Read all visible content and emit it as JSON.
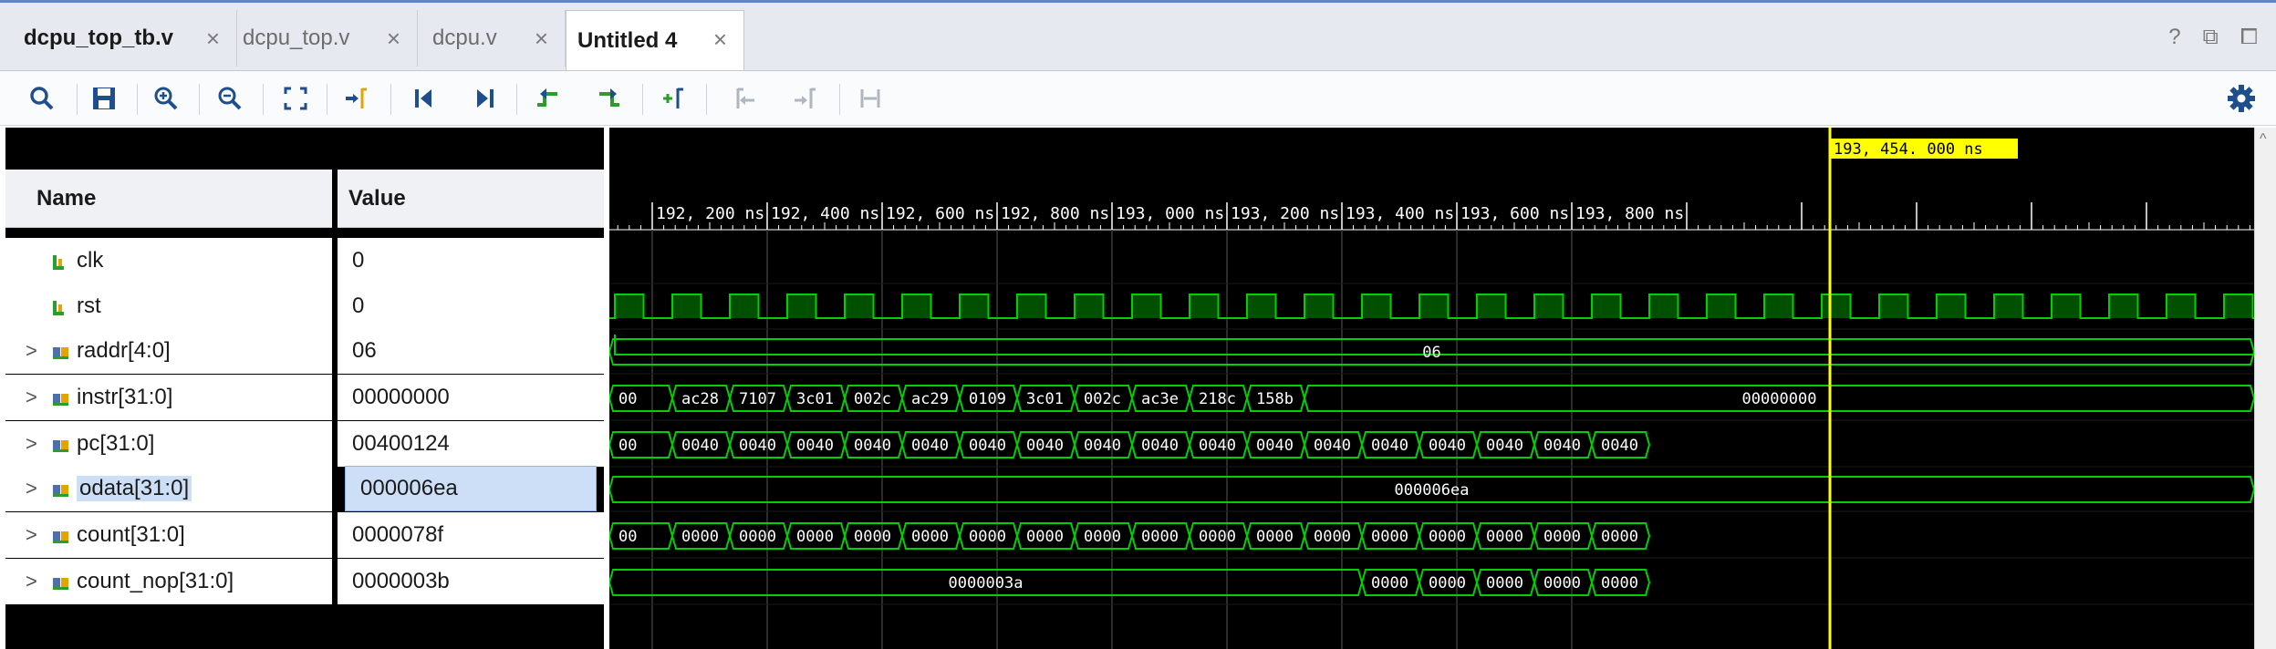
{
  "tabs": [
    {
      "label": "dcpu_top_tb.v",
      "active": false
    },
    {
      "label": "dcpu_top.v",
      "active": false
    },
    {
      "label": "dcpu.v",
      "active": false
    },
    {
      "label": "Untitled 4",
      "active": true
    }
  ],
  "window_controls": {
    "help": "?",
    "restore": "⧉",
    "maximize": "⧠"
  },
  "toolbar": {
    "buttons": [
      "search",
      "save",
      "zoom-in",
      "zoom-out",
      "zoom-fit",
      "go-to-cursor",
      "go-to-time-0",
      "go-to-last-time",
      "previous-transition",
      "next-transition",
      "add-marker",
      "previous-marker",
      "next-marker",
      "swap-cursors"
    ],
    "settings_icon": "gear-icon"
  },
  "columns": {
    "name": "Name",
    "value": "Value"
  },
  "signals": [
    {
      "name": "clk",
      "value": "0",
      "kind": "bit",
      "expandable": false
    },
    {
      "name": "rst",
      "value": "0",
      "kind": "bit",
      "expandable": false
    },
    {
      "name": "raddr[4:0]",
      "value": "06",
      "kind": "bus",
      "expandable": true
    },
    {
      "name": "instr[31:0]",
      "value": "00000000",
      "kind": "bus",
      "expandable": true
    },
    {
      "name": "pc[31:0]",
      "value": "00400124",
      "kind": "bus",
      "expandable": true
    },
    {
      "name": "odata[31:0]",
      "value": "000006ea",
      "kind": "bus",
      "expandable": true,
      "selected": true
    },
    {
      "name": "count[31:0]",
      "value": "0000078f",
      "kind": "bus",
      "expandable": true
    },
    {
      "name": "count_nop[31:0]",
      "value": "0000003b",
      "kind": "bus",
      "expandable": true
    }
  ],
  "timeline": {
    "tick_labels": [
      "192, 200 ns",
      "192, 400 ns",
      "192, 600 ns",
      "192, 800 ns",
      "193, 000 ns",
      "193, 200 ns",
      "193, 400 ns",
      "193, 600 ns",
      "193, 800 ns"
    ],
    "cursor_label": "193, 454. 000  ns",
    "cursor_color": "#ffff00"
  },
  "waveforms": {
    "wave_color": "#00d000",
    "raddr": [
      "06"
    ],
    "instr": [
      "00",
      "ac28",
      "7107",
      "3c01",
      "002c",
      "ac29",
      "0109",
      "3c01",
      "002c",
      "ac3e",
      "218c",
      "158b",
      "00000000"
    ],
    "pc": [
      "00",
      "0040",
      "0040",
      "0040",
      "0040",
      "0040",
      "0040",
      "0040",
      "0040",
      "0040",
      "0040",
      "0040",
      "0040",
      "0040",
      "0040",
      "0040",
      "0040",
      "0040"
    ],
    "odata": [
      "000006ea"
    ],
    "count": [
      "00",
      "0000",
      "0000",
      "0000",
      "0000",
      "0000",
      "0000",
      "0000",
      "0000",
      "0000",
      "0000",
      "0000",
      "0000",
      "0000",
      "0000",
      "0000",
      "0000",
      "0000"
    ],
    "count_nop": [
      "0000003a",
      "0000",
      "0000",
      "0000",
      "0000",
      "0000"
    ]
  }
}
